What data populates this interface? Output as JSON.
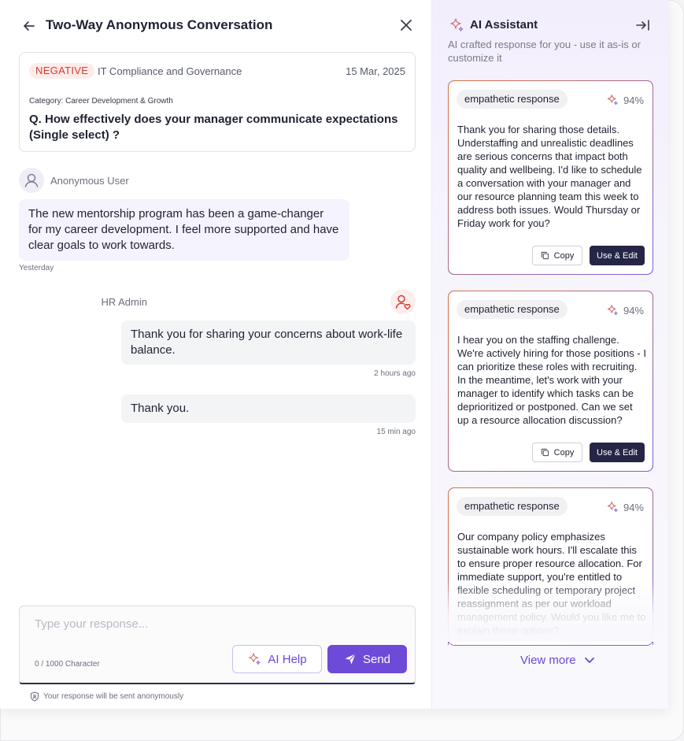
{
  "header": {
    "title": "Two-Way Anonymous Conversation"
  },
  "question_card": {
    "sentiment": "NEGATIVE",
    "topic": "IT Compliance and Governance",
    "date": "15 Mar, 2025",
    "category": "Category: Career Development & Growth",
    "question": "Q. How effectively does your manager communicate expectations (Single select) ?"
  },
  "messages": [
    {
      "sender": "Anonymous User",
      "text": "The new mentorship program has been a game-changer for my career development. I feel more supported and have clear goals to work towards.",
      "time": "Yesterday"
    },
    {
      "sender": "HR Admin",
      "text": "Thank you for sharing your concerns about work-life balance.",
      "time": "2 hours ago"
    },
    {
      "sender": "HR Admin",
      "text": "Thank you.",
      "time": "15 min ago"
    }
  ],
  "composer": {
    "placeholder": "Type your response...",
    "char_count": "0 / 1000 Character",
    "ai_help_label": "AI Help",
    "send_label": "Send",
    "anon_note": "Your response will be sent anonymously"
  },
  "assistant": {
    "title": "AI Assistant",
    "subtitle": "AI crafted response for you - use it as-is or customize it",
    "copy_label": "Copy",
    "use_edit_label": "Use & Edit",
    "view_more_label": "View more",
    "suggestions": [
      {
        "tag": "empathetic response",
        "score": "94%",
        "text": "Thank you for sharing those details. Understaffing and unrealistic deadlines are serious concerns that impact both quality and wellbeing. I'd like to schedule a conversation with your manager and our resource planning team this week to address both issues. Would Thursday or Friday work for you?"
      },
      {
        "tag": "empathetic response",
        "score": "94%",
        "text": "I hear you on the staffing challenge. We're actively hiring for those positions - I can prioritize these roles with recruiting. In the meantime, let's work with your manager to identify which tasks can be deprioritized or postponed. Can we set up a resource allocation discussion?"
      },
      {
        "tag": "empathetic response",
        "score": "94%",
        "text": "Our company policy emphasizes sustainable work hours. I'll escalate this to ensure proper resource allocation. For immediate support, you're entitled to flexible scheduling or temporary project reassignment as per our workload management policy. Would you like me to explain these options?"
      }
    ]
  },
  "colors": {
    "accent": "#6e4ad8",
    "negative_tag": "#d8392c",
    "dark_button": "#252547"
  }
}
